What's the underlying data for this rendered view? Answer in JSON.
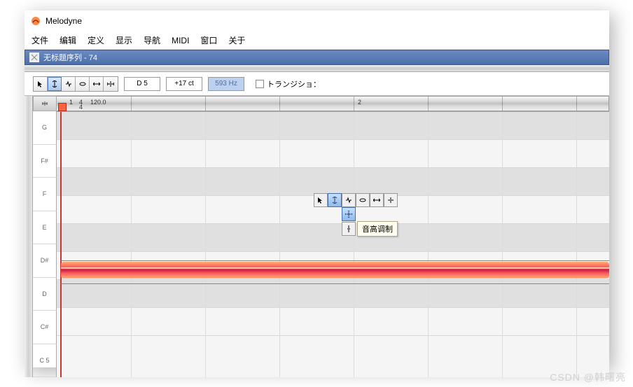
{
  "app": {
    "title": "Melodyne"
  },
  "menu": {
    "items": [
      "文件",
      "编辑",
      "定义",
      "显示",
      "导航",
      "MIDI",
      "窗口",
      "关于"
    ]
  },
  "document": {
    "title": "无标题序列 - 74"
  },
  "toolbar": {
    "note": "D 5",
    "cents": "+17 ct",
    "freq": "593 Hz",
    "checkbox_label": "トランジショ："
  },
  "ruler": {
    "bar1": "1",
    "tsig_num": "4",
    "tsig_den": "4",
    "tempo": "120.0",
    "bar2": "2"
  },
  "piano": {
    "labels": [
      "G",
      "F#",
      "F",
      "E",
      "D#",
      "D",
      "C#",
      "C 5"
    ]
  },
  "context_menu": {
    "tooltip": "音高调制"
  },
  "watermark": "CSDN @韩曙亮"
}
